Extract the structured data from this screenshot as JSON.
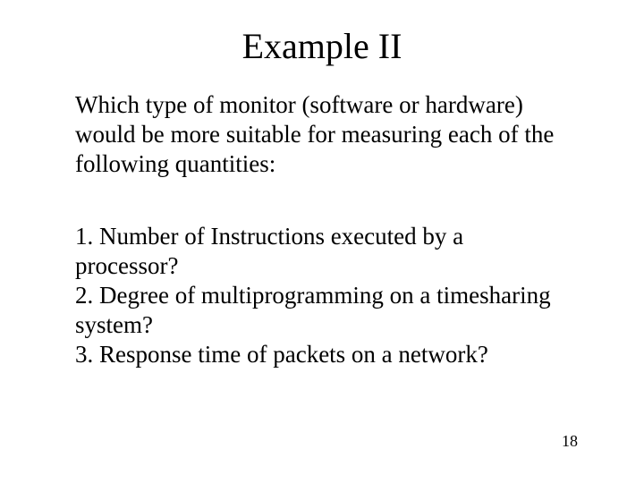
{
  "title": "Example II",
  "intro": "Which type of monitor (software or hardware) would be more suitable for measuring each of the following quantities:",
  "questions": {
    "q1": "1. Number of Instructions executed by a processor?",
    "q2": "2. Degree of multiprogramming on a timesharing system?",
    "q3": "3. Response time of packets on a network?"
  },
  "page_number": "18"
}
